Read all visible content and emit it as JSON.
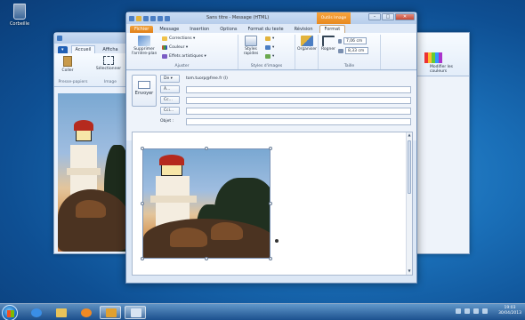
{
  "desktop": {
    "recycle_label": "Corbeille"
  },
  "paint": {
    "tabs": [
      "Accueil",
      "Afficha"
    ],
    "buttons": [
      "Coller",
      "Sélectionner"
    ],
    "groups": [
      "Presse-papiers",
      "Image"
    ]
  },
  "right_window": {
    "button_label": "Modifier les couleurs"
  },
  "outlook": {
    "title": "Sans titre - Message (HTML)",
    "context_tab": "Outils Image",
    "window_controls": [
      "–",
      "□",
      "✕"
    ],
    "tabs": [
      "Fichier",
      "Message",
      "Insertion",
      "Options",
      "Format du texte",
      "Révision",
      "Format"
    ],
    "ribbon": {
      "adjust": {
        "remove_bg": "Supprimer l'arrière-plan",
        "corrections": "Corrections ▾",
        "color": "Couleur ▾",
        "artistic": "Effets artistiques ▾",
        "label": "Ajuster"
      },
      "styles": {
        "quick": "Styles rapides",
        "label": "Styles d'images"
      },
      "arrange": {
        "organize": "Organiser"
      },
      "size": {
        "crop": "Rogner",
        "height": "7,06 cm",
        "width": "8,33 cm",
        "label": "Taille"
      }
    },
    "header": {
      "send": "Envoyer",
      "from_btn": "De ▾",
      "from_value": "tom.tuorp@free.fr (I)",
      "to_btn": "À...",
      "cc_btn": "Cc...",
      "bcc_btn": "Cci...",
      "subject_label": "Objet :"
    }
  },
  "taskbar": {
    "time": "19:03",
    "date": "30/04/2013"
  }
}
